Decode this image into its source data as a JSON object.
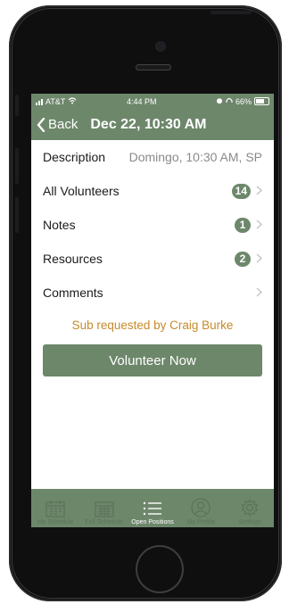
{
  "status": {
    "carrier": "AT&T",
    "time": "4:44 PM",
    "battery": "66%"
  },
  "nav": {
    "back_label": "Back",
    "title": "Dec 22, 10:30 AM"
  },
  "rows": {
    "description": {
      "label": "Description",
      "value": "Domingo, 10:30 AM, SP"
    },
    "volunteers": {
      "label": "All Volunteers",
      "count": "14"
    },
    "notes": {
      "label": "Notes",
      "count": "1"
    },
    "resources": {
      "label": "Resources",
      "count": "2"
    },
    "comments": {
      "label": "Comments"
    }
  },
  "sub_notice": "Sub requested by Craig Burke",
  "volunteer_button": "Volunteer Now",
  "tabs": [
    {
      "label": "My Schedule",
      "icon": "calendar-icon"
    },
    {
      "label": "Full Schedule",
      "icon": "calendar-grid-icon"
    },
    {
      "label": "Open Positions",
      "icon": "list-icon"
    },
    {
      "label": "My Profile",
      "icon": "person-icon"
    },
    {
      "label": "Settings",
      "icon": "gear-icon"
    }
  ],
  "colors": {
    "accent": "#6d876b",
    "notice": "#c68a2b"
  }
}
